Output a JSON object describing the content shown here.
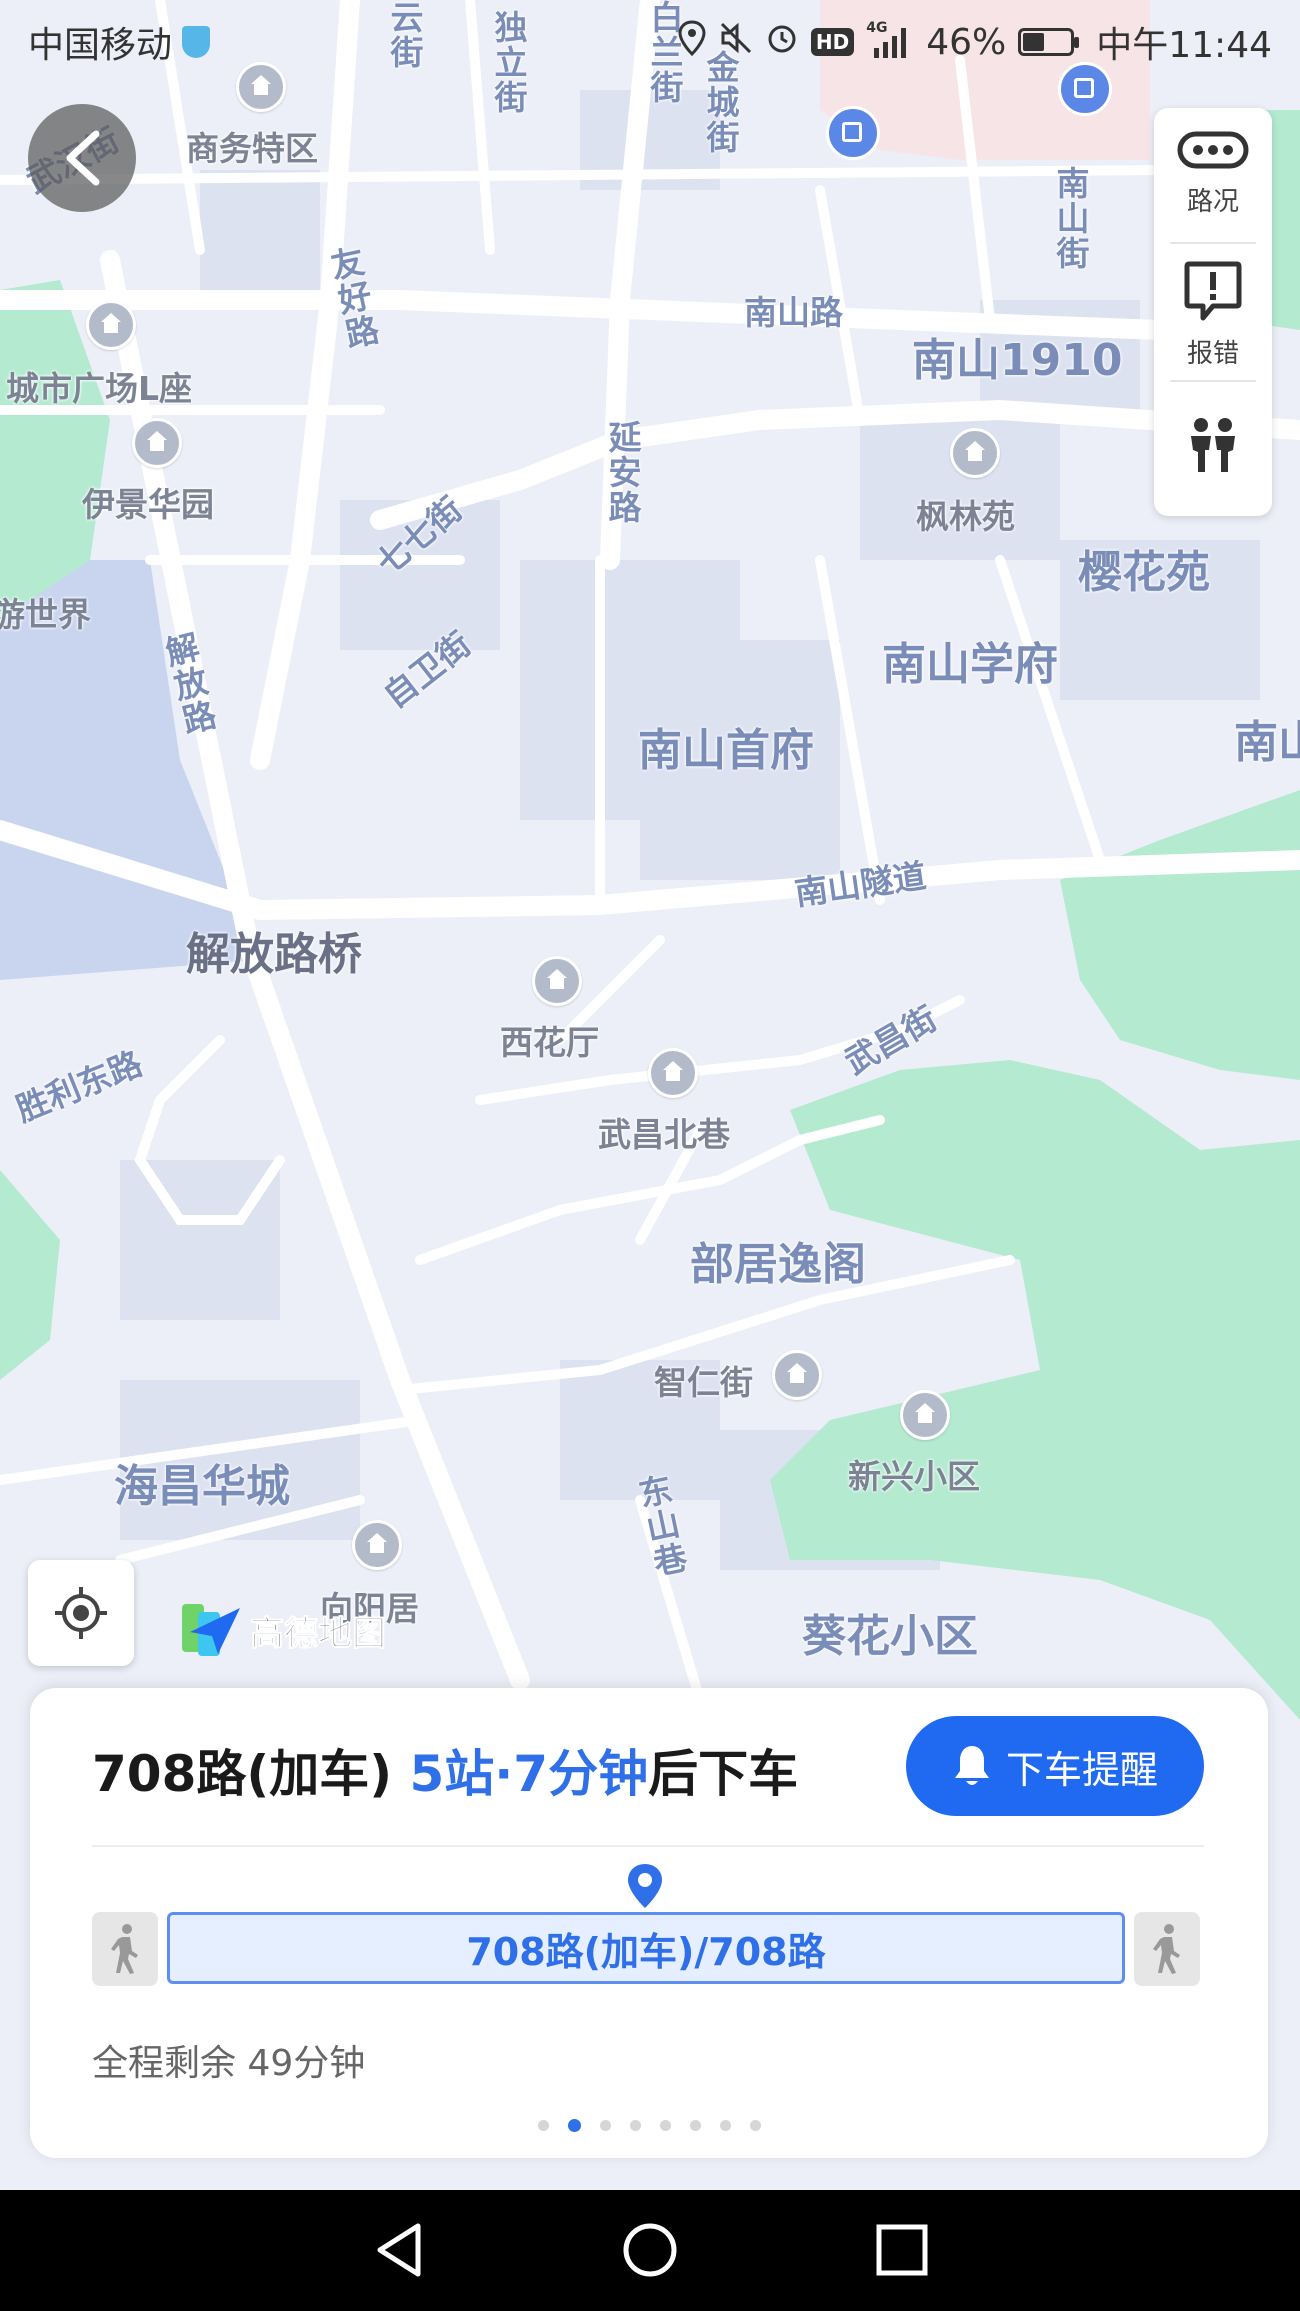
{
  "status_bar": {
    "carrier": "中国移动",
    "network": "4G",
    "hd": "HD",
    "battery_text": "46%",
    "battery_level": 0.46,
    "time": "中午11:44"
  },
  "map": {
    "street_labels": [
      {
        "text": "云街",
        "vertical": true
      },
      {
        "text": "独立街",
        "vertical": true
      },
      {
        "text": "白兰街",
        "vertical": true
      },
      {
        "text": "金城街",
        "vertical": true
      },
      {
        "text": "南山街",
        "vertical": true
      },
      {
        "text": "友好路",
        "vertical": true
      },
      {
        "text": "延安路",
        "vertical": true
      },
      {
        "text": "解放路",
        "vertical": true
      },
      {
        "text": "东山巷",
        "vertical": true
      },
      {
        "text": "武汉街"
      },
      {
        "text": "南山路"
      },
      {
        "text": "七七街"
      },
      {
        "text": "自卫街"
      },
      {
        "text": "南山隧道"
      },
      {
        "text": "胜利东路"
      },
      {
        "text": "武昌街"
      }
    ],
    "area_labels": [
      "南山1910",
      "樱花苑",
      "南山学府",
      "南山首府",
      "南山",
      "部居逸阁",
      "海昌华城",
      "葵花小区"
    ],
    "bridge_label": "解放路桥",
    "pois": [
      "商务特区",
      "城市广场L座",
      "伊景华园",
      "游世界",
      "枫林苑",
      "西花厅",
      "武昌北巷",
      "智仁街",
      "新兴小区",
      "向阳居"
    ]
  },
  "toolbar": {
    "traffic_label": "路况",
    "report_label": "报错"
  },
  "logo": {
    "text": "高德地图"
  },
  "card": {
    "route_name": "708路(加车)",
    "stops_time": "5站·7分钟",
    "suffix": "后下车",
    "alert_button": "下车提醒",
    "bus_line": "708路(加车)/708路",
    "remaining": "全程剩余 49分钟",
    "page_count": 8,
    "active_page": 1
  },
  "colors": {
    "accent": "#2f6fe8",
    "park_green": "#a9e7c4",
    "road_white": "#ffffff",
    "block_fill": "#dfe4f2"
  }
}
